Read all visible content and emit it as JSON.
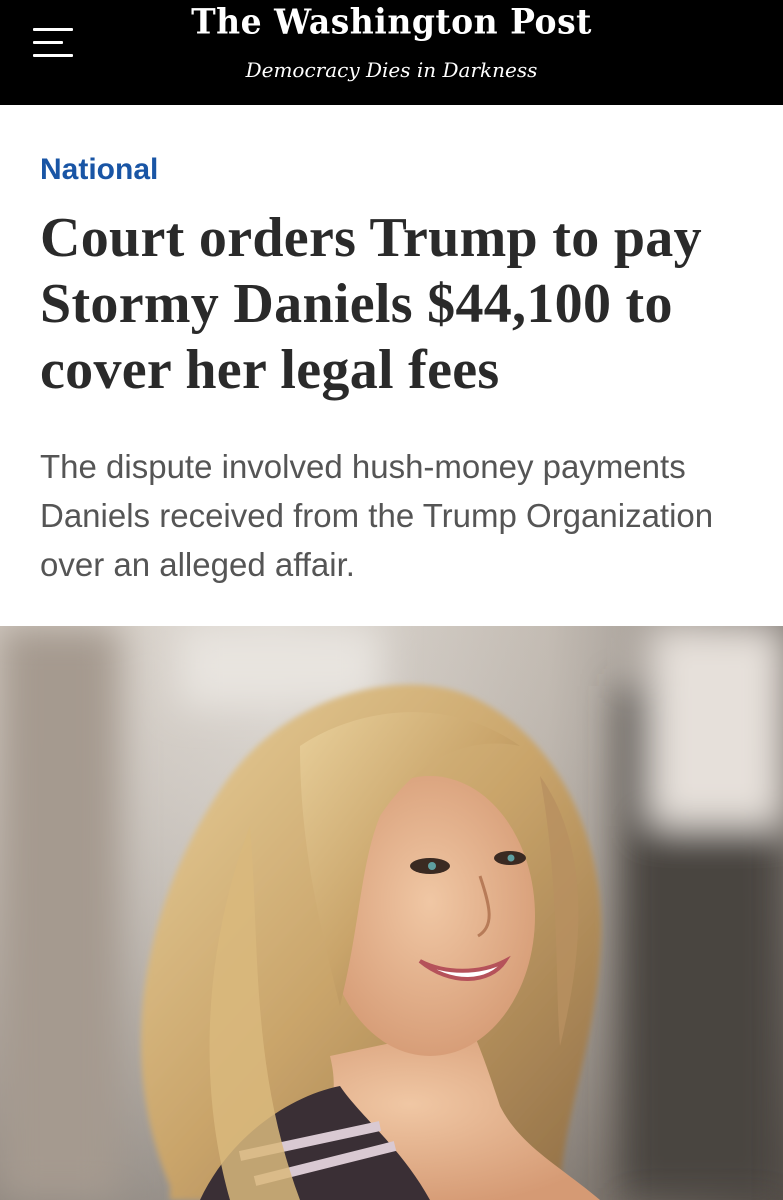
{
  "header": {
    "menu_icon": "hamburger-menu-icon",
    "masthead": "The Washington Post",
    "tagline": "Democracy Dies in Darkness",
    "background_color": "#000000"
  },
  "article": {
    "section": "National",
    "section_color": "#1955a5",
    "headline": "Court orders Trump to pay Stormy Daniels $44,100 to cover her legal fees",
    "dek": "The dispute involved hush-money payments Daniels received from the Trump Organization over an alleged affair."
  }
}
